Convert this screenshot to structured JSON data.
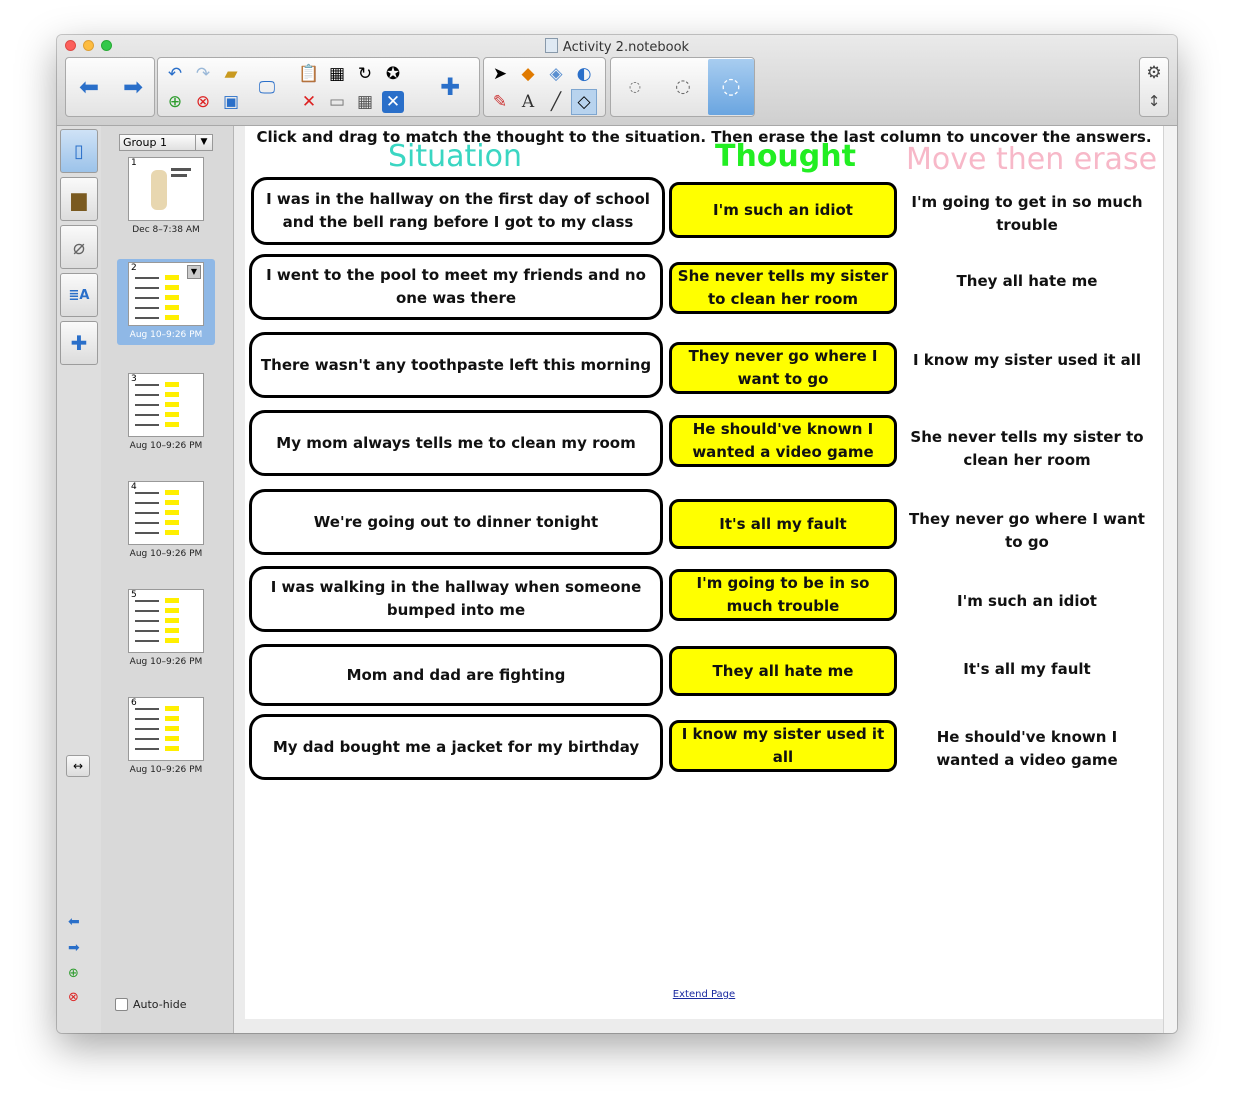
{
  "window": {
    "title": "Activity 2.notebook"
  },
  "toolbar": {
    "back_icon": "arrow-left",
    "forward_icon": "arrow-right",
    "undo_icon": "undo",
    "redo_icon": "redo",
    "settings_icon": "gear",
    "expand_icon": "up-down-arrows"
  },
  "sorter": {
    "group": "Group 1",
    "pages": [
      {
        "num": "1",
        "time": "Dec 8–7:38 AM"
      },
      {
        "num": "2",
        "time": "Aug 10–9:26 PM"
      },
      {
        "num": "3",
        "time": "Aug 10–9:26 PM"
      },
      {
        "num": "4",
        "time": "Aug 10–9:26 PM"
      },
      {
        "num": "5",
        "time": "Aug 10–9:26 PM"
      },
      {
        "num": "6",
        "time": "Aug 10–9:26 PM"
      }
    ],
    "autohide": "Auto-hide"
  },
  "page": {
    "instruction": "Click and drag to match the thought to the situation. Then erase the last column to uncover the answers.",
    "headers": {
      "situation": "Situation",
      "thought": "Thought",
      "erase": "Move then erase"
    },
    "colors": {
      "situation": "#3ad6c2",
      "thought": "#22ee22",
      "erase": "#f7b8c8",
      "thought_box": "#ffff00"
    },
    "situations": [
      "I was in the hallway on the first day of school and the bell rang before I got to my class",
      "I went to the pool to meet my friends and no one was there",
      "There wasn't any toothpaste left this morning",
      "My mom always tells me to clean my room",
      "We're going out to dinner tonight",
      "I was walking in the hallway when someone bumped into me",
      "Mom and dad are fighting",
      "My dad bought me a jacket for my birthday"
    ],
    "thoughts": [
      "I'm such an idiot",
      "She never tells my sister to clean her room",
      "They never go where I want to go",
      "He should've known I wanted a video game",
      "It's all my fault",
      "I'm going to be in so much trouble",
      "They all hate me",
      "I know my sister used it all"
    ],
    "answers": [
      "I'm going to get in so much trouble",
      "They all hate me",
      "I know my sister used it all",
      "She never tells my sister to clean her room",
      "They never go where I want to go",
      "I'm such an idiot",
      "It's all my fault",
      "He should've known I wanted a video game"
    ],
    "extend": "Extend Page"
  }
}
